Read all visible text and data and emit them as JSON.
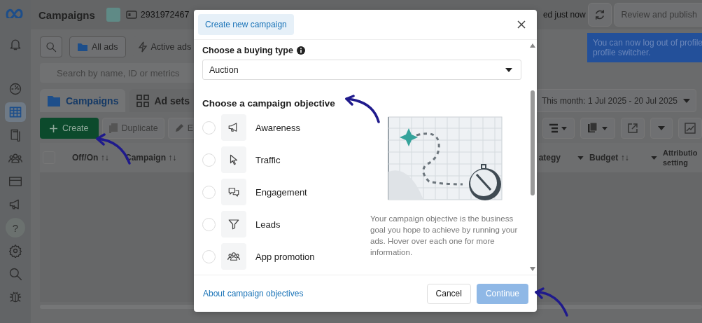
{
  "topbar": {
    "title": "Campaigns",
    "account_id": "2931972467",
    "save_status": "ed just now",
    "publish_button": "Review and publish"
  },
  "toast": {
    "lines": [
      "You can now log out of profile",
      "profile switcher."
    ]
  },
  "sidebar": {
    "items": [
      {
        "selected": false
      },
      {
        "selected": false
      },
      {
        "selected": true
      },
      {
        "selected": false
      },
      {
        "selected": false
      },
      {
        "selected": false
      },
      {
        "selected": false
      },
      {
        "selected": false,
        "label": "?"
      },
      {
        "selected": false
      },
      {
        "selected": false
      },
      {
        "selected": false
      }
    ]
  },
  "filters": [
    {
      "label": "All ads",
      "selected": true
    },
    {
      "label": "Active ads",
      "selected": false
    }
  ],
  "search": {
    "placeholder": "Search by name, ID or metrics"
  },
  "tabs": [
    {
      "label": "Campaigns",
      "selected": true
    },
    {
      "label": "Ad sets",
      "selected": false
    }
  ],
  "date_range": "This month: 1 Jul 2025 - 20 Jul 2025",
  "toolbar": {
    "create": "Create",
    "duplicate": "Duplicate",
    "edit": "E"
  },
  "table": {
    "select_all": {
      "checked": false
    },
    "columns": [
      {
        "label": "Off/On ↑↓"
      },
      {
        "label": "Campaign ↑↓"
      },
      {
        "label": "ategy"
      },
      {
        "label": "Budget ↑↓"
      },
      {
        "label": "Attributio setting"
      }
    ]
  },
  "dialog": {
    "tab": "Create new campaign",
    "buying_type_label": "Choose a buying type",
    "buying_type": "Auction",
    "objective_heading": "Choose a campaign objective",
    "objectives": [
      {
        "label": "Awareness",
        "selected": false
      },
      {
        "label": "Traffic",
        "selected": false
      },
      {
        "label": "Engagement",
        "selected": false
      },
      {
        "label": "Leads",
        "selected": false
      },
      {
        "label": "App promotion",
        "selected": false
      }
    ],
    "description": "Your campaign objective is the business goal you hope to achieve by running your ads. Hover over each one for more information.",
    "help_link": "About campaign objectives",
    "cancel": "Cancel",
    "continue": {
      "label": "Continue",
      "disabled": true
    }
  }
}
